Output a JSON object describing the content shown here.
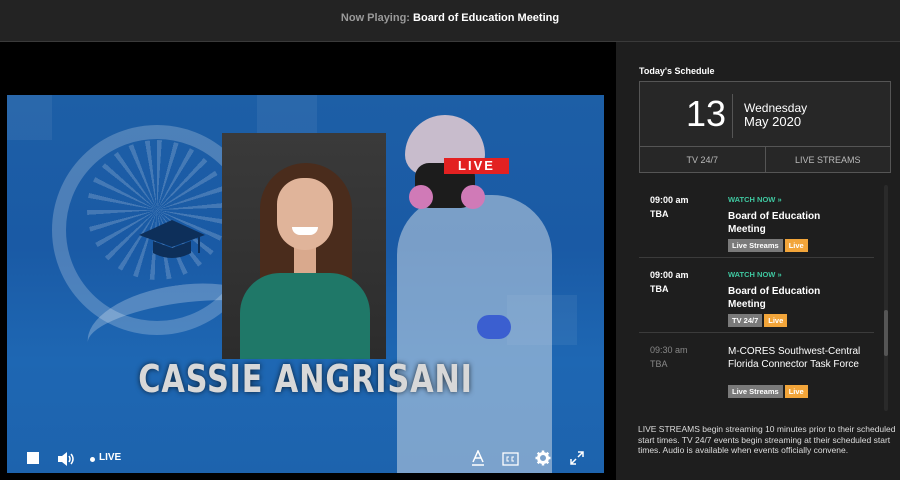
{
  "now_playing": {
    "prefix": "Now Playing:",
    "title": "Board of Education Meeting"
  },
  "video": {
    "live_badge": "LIVE",
    "lower_third_name": "CASSIE ANGRISANI",
    "controls": {
      "live_label": "LIVE"
    }
  },
  "schedule": {
    "heading": "Today's Schedule",
    "date": {
      "day": "13",
      "weekday": "Wednesday",
      "month_year": "May 2020"
    },
    "tabs": [
      {
        "label": "TV 24/7"
      },
      {
        "label": "LIVE STREAMS"
      }
    ],
    "items": [
      {
        "time": "09:00 am",
        "location": "TBA",
        "watch": "WATCH NOW",
        "title": "Board of Education Meeting",
        "tags": [
          "Live Streams",
          "Live"
        ]
      },
      {
        "time": "09:00 am",
        "location": "TBA",
        "watch": "WATCH NOW",
        "title": "Board of Education Meeting",
        "tags": [
          "TV 24/7",
          "Live"
        ]
      },
      {
        "time": "09:30 am",
        "location": "TBA",
        "title": "M-CORES Southwest-Central Florida Connector Task Force",
        "tags": [
          "Live Streams",
          "Live"
        ]
      }
    ],
    "footnote": "LIVE STREAMS begin streaming 10 minutes prior to their scheduled start times. TV 24/7 events begin streaming at their scheduled start times. Audio is available when events officially convene."
  },
  "colors": {
    "accent_green": "#3fc7a0",
    "tag_orange": "#f2a53a",
    "tag_gray": "#7a7a7a",
    "live_red": "#e32121"
  },
  "icons": [
    "stop-icon",
    "volume-icon",
    "live-dot-icon",
    "text-style-icon",
    "closed-captions-icon",
    "settings-gear-icon",
    "fullscreen-icon",
    "double-chevron-right-icon"
  ]
}
